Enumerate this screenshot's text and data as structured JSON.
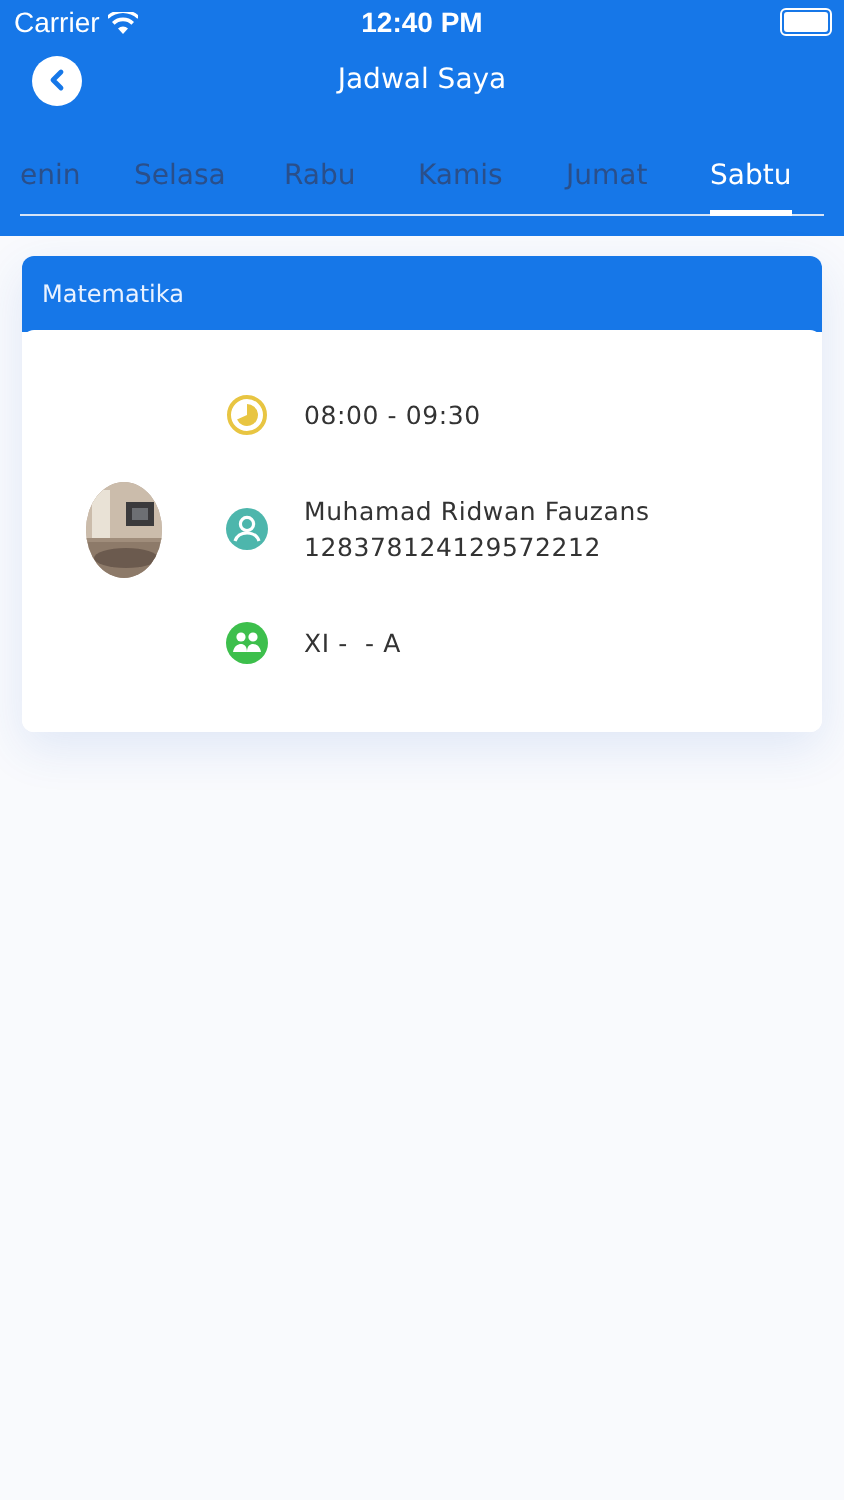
{
  "status_bar": {
    "carrier": "Carrier",
    "time": "12:40 PM"
  },
  "nav": {
    "title": "Jadwal Saya"
  },
  "tabs": [
    {
      "label": "enin",
      "selected": false
    },
    {
      "label": "Selasa",
      "selected": false
    },
    {
      "label": "Rabu",
      "selected": false
    },
    {
      "label": "Kamis",
      "selected": false
    },
    {
      "label": "Jumat",
      "selected": false
    },
    {
      "label": "Sabtu",
      "selected": true
    }
  ],
  "schedule": [
    {
      "subject": "Matematika",
      "time": "08:00 - 09:30",
      "teacher": "Muhamad Ridwan Fauzans",
      "teacher_id": "128378124129572212",
      "class": "XI -  - A"
    }
  ]
}
